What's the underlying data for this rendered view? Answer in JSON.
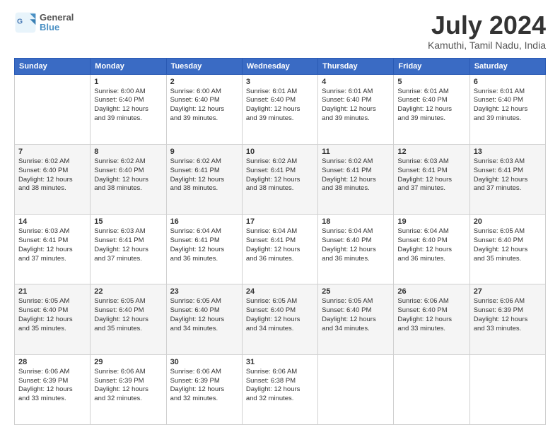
{
  "logo": {
    "line1": "General",
    "line2": "Blue"
  },
  "header": {
    "month": "July 2024",
    "location": "Kamuthi, Tamil Nadu, India"
  },
  "weekdays": [
    "Sunday",
    "Monday",
    "Tuesday",
    "Wednesday",
    "Thursday",
    "Friday",
    "Saturday"
  ],
  "weeks": [
    [
      {
        "day": "",
        "text": ""
      },
      {
        "day": "1",
        "text": "Sunrise: 6:00 AM\nSunset: 6:40 PM\nDaylight: 12 hours\nand 39 minutes."
      },
      {
        "day": "2",
        "text": "Sunrise: 6:00 AM\nSunset: 6:40 PM\nDaylight: 12 hours\nand 39 minutes."
      },
      {
        "day": "3",
        "text": "Sunrise: 6:01 AM\nSunset: 6:40 PM\nDaylight: 12 hours\nand 39 minutes."
      },
      {
        "day": "4",
        "text": "Sunrise: 6:01 AM\nSunset: 6:40 PM\nDaylight: 12 hours\nand 39 minutes."
      },
      {
        "day": "5",
        "text": "Sunrise: 6:01 AM\nSunset: 6:40 PM\nDaylight: 12 hours\nand 39 minutes."
      },
      {
        "day": "6",
        "text": "Sunrise: 6:01 AM\nSunset: 6:40 PM\nDaylight: 12 hours\nand 39 minutes."
      }
    ],
    [
      {
        "day": "7",
        "text": "Sunrise: 6:02 AM\nSunset: 6:40 PM\nDaylight: 12 hours\nand 38 minutes."
      },
      {
        "day": "8",
        "text": "Sunrise: 6:02 AM\nSunset: 6:40 PM\nDaylight: 12 hours\nand 38 minutes."
      },
      {
        "day": "9",
        "text": "Sunrise: 6:02 AM\nSunset: 6:41 PM\nDaylight: 12 hours\nand 38 minutes."
      },
      {
        "day": "10",
        "text": "Sunrise: 6:02 AM\nSunset: 6:41 PM\nDaylight: 12 hours\nand 38 minutes."
      },
      {
        "day": "11",
        "text": "Sunrise: 6:02 AM\nSunset: 6:41 PM\nDaylight: 12 hours\nand 38 minutes."
      },
      {
        "day": "12",
        "text": "Sunrise: 6:03 AM\nSunset: 6:41 PM\nDaylight: 12 hours\nand 37 minutes."
      },
      {
        "day": "13",
        "text": "Sunrise: 6:03 AM\nSunset: 6:41 PM\nDaylight: 12 hours\nand 37 minutes."
      }
    ],
    [
      {
        "day": "14",
        "text": "Sunrise: 6:03 AM\nSunset: 6:41 PM\nDaylight: 12 hours\nand 37 minutes."
      },
      {
        "day": "15",
        "text": "Sunrise: 6:03 AM\nSunset: 6:41 PM\nDaylight: 12 hours\nand 37 minutes."
      },
      {
        "day": "16",
        "text": "Sunrise: 6:04 AM\nSunset: 6:41 PM\nDaylight: 12 hours\nand 36 minutes."
      },
      {
        "day": "17",
        "text": "Sunrise: 6:04 AM\nSunset: 6:41 PM\nDaylight: 12 hours\nand 36 minutes."
      },
      {
        "day": "18",
        "text": "Sunrise: 6:04 AM\nSunset: 6:40 PM\nDaylight: 12 hours\nand 36 minutes."
      },
      {
        "day": "19",
        "text": "Sunrise: 6:04 AM\nSunset: 6:40 PM\nDaylight: 12 hours\nand 36 minutes."
      },
      {
        "day": "20",
        "text": "Sunrise: 6:05 AM\nSunset: 6:40 PM\nDaylight: 12 hours\nand 35 minutes."
      }
    ],
    [
      {
        "day": "21",
        "text": "Sunrise: 6:05 AM\nSunset: 6:40 PM\nDaylight: 12 hours\nand 35 minutes."
      },
      {
        "day": "22",
        "text": "Sunrise: 6:05 AM\nSunset: 6:40 PM\nDaylight: 12 hours\nand 35 minutes."
      },
      {
        "day": "23",
        "text": "Sunrise: 6:05 AM\nSunset: 6:40 PM\nDaylight: 12 hours\nand 34 minutes."
      },
      {
        "day": "24",
        "text": "Sunrise: 6:05 AM\nSunset: 6:40 PM\nDaylight: 12 hours\nand 34 minutes."
      },
      {
        "day": "25",
        "text": "Sunrise: 6:05 AM\nSunset: 6:40 PM\nDaylight: 12 hours\nand 34 minutes."
      },
      {
        "day": "26",
        "text": "Sunrise: 6:06 AM\nSunset: 6:40 PM\nDaylight: 12 hours\nand 33 minutes."
      },
      {
        "day": "27",
        "text": "Sunrise: 6:06 AM\nSunset: 6:39 PM\nDaylight: 12 hours\nand 33 minutes."
      }
    ],
    [
      {
        "day": "28",
        "text": "Sunrise: 6:06 AM\nSunset: 6:39 PM\nDaylight: 12 hours\nand 33 minutes."
      },
      {
        "day": "29",
        "text": "Sunrise: 6:06 AM\nSunset: 6:39 PM\nDaylight: 12 hours\nand 32 minutes."
      },
      {
        "day": "30",
        "text": "Sunrise: 6:06 AM\nSunset: 6:39 PM\nDaylight: 12 hours\nand 32 minutes."
      },
      {
        "day": "31",
        "text": "Sunrise: 6:06 AM\nSunset: 6:38 PM\nDaylight: 12 hours\nand 32 minutes."
      },
      {
        "day": "",
        "text": ""
      },
      {
        "day": "",
        "text": ""
      },
      {
        "day": "",
        "text": ""
      }
    ]
  ]
}
